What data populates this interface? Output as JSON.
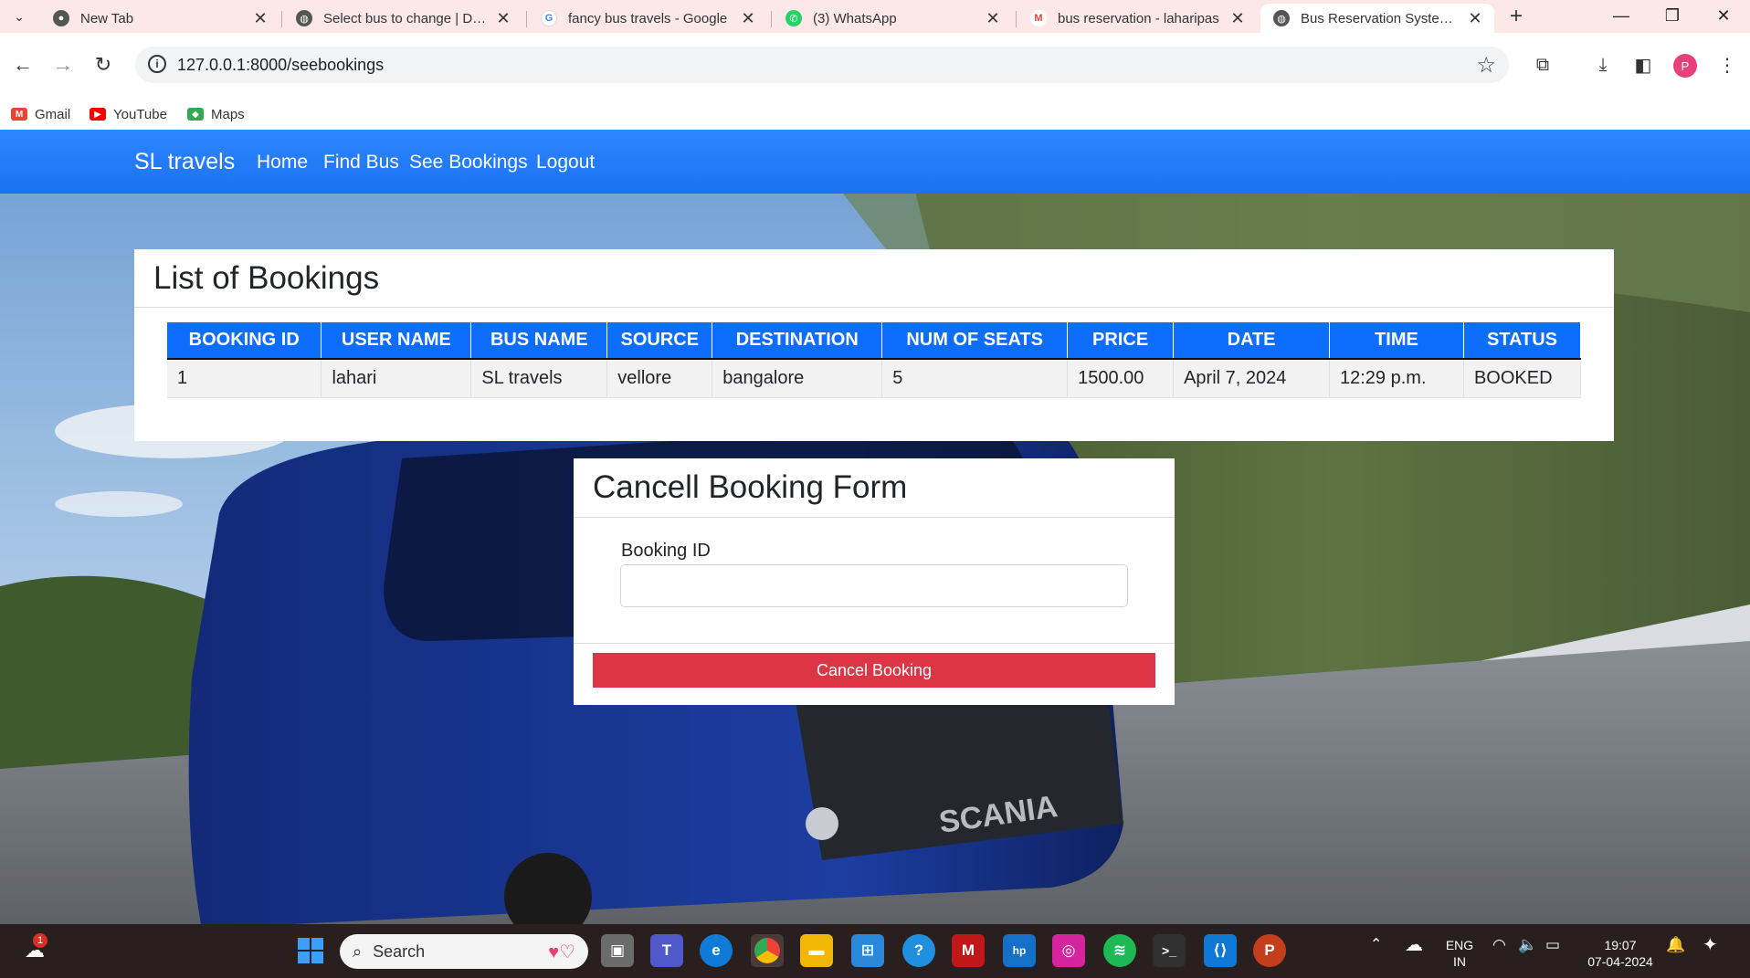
{
  "browser": {
    "tabs": [
      {
        "title": "New Tab",
        "icon": "chrome-icon",
        "active": false
      },
      {
        "title": "Select bus to change | Djan",
        "icon": "globe-icon",
        "active": false
      },
      {
        "title": "fancy bus travels - Google",
        "icon": "google-icon",
        "active": false
      },
      {
        "title": "(3) WhatsApp",
        "icon": "whatsapp-icon",
        "active": false
      },
      {
        "title": "bus reservation - laharipas",
        "icon": "gmail-icon",
        "active": false
      },
      {
        "title": "Bus Reservation System in",
        "icon": "globe-icon",
        "active": true
      }
    ],
    "url": "127.0.0.1:8000/seebookings",
    "bookmarks": [
      {
        "label": "Gmail",
        "icon": "gmail-icon",
        "color": "#ea4335"
      },
      {
        "label": "YouTube",
        "icon": "youtube-icon",
        "color": "#ff0000"
      },
      {
        "label": "Maps",
        "icon": "maps-icon",
        "color": "#34a853"
      }
    ],
    "profile_initial": "P"
  },
  "navbar": {
    "brand": "SL travels",
    "links": [
      "Home",
      "Find Bus",
      "See Bookings",
      "Logout"
    ],
    "color": "#1a72f2"
  },
  "bookings": {
    "title": "List of Bookings",
    "columns": [
      "BOOKING ID",
      "USER NAME",
      "BUS NAME",
      "SOURCE",
      "DESTINATION",
      "NUM OF SEATS",
      "PRICE",
      "DATE",
      "TIME",
      "STATUS"
    ],
    "rows": [
      [
        "1",
        "lahari",
        "SL travels",
        "vellore",
        "bangalore",
        "5",
        "1500.00",
        "April 7, 2024",
        "12:29 p.m.",
        "BOOKED"
      ]
    ]
  },
  "cancel_form": {
    "title": "Cancell Booking Form",
    "field_label": "Booking ID",
    "field_value": "",
    "button_label": "Cancel Booking",
    "button_color": "#dc3545"
  },
  "taskbar": {
    "search_placeholder": "Search",
    "weather_badge": "1",
    "language": "ENG",
    "region": "IN",
    "time": "19:07",
    "date": "07-04-2024"
  }
}
